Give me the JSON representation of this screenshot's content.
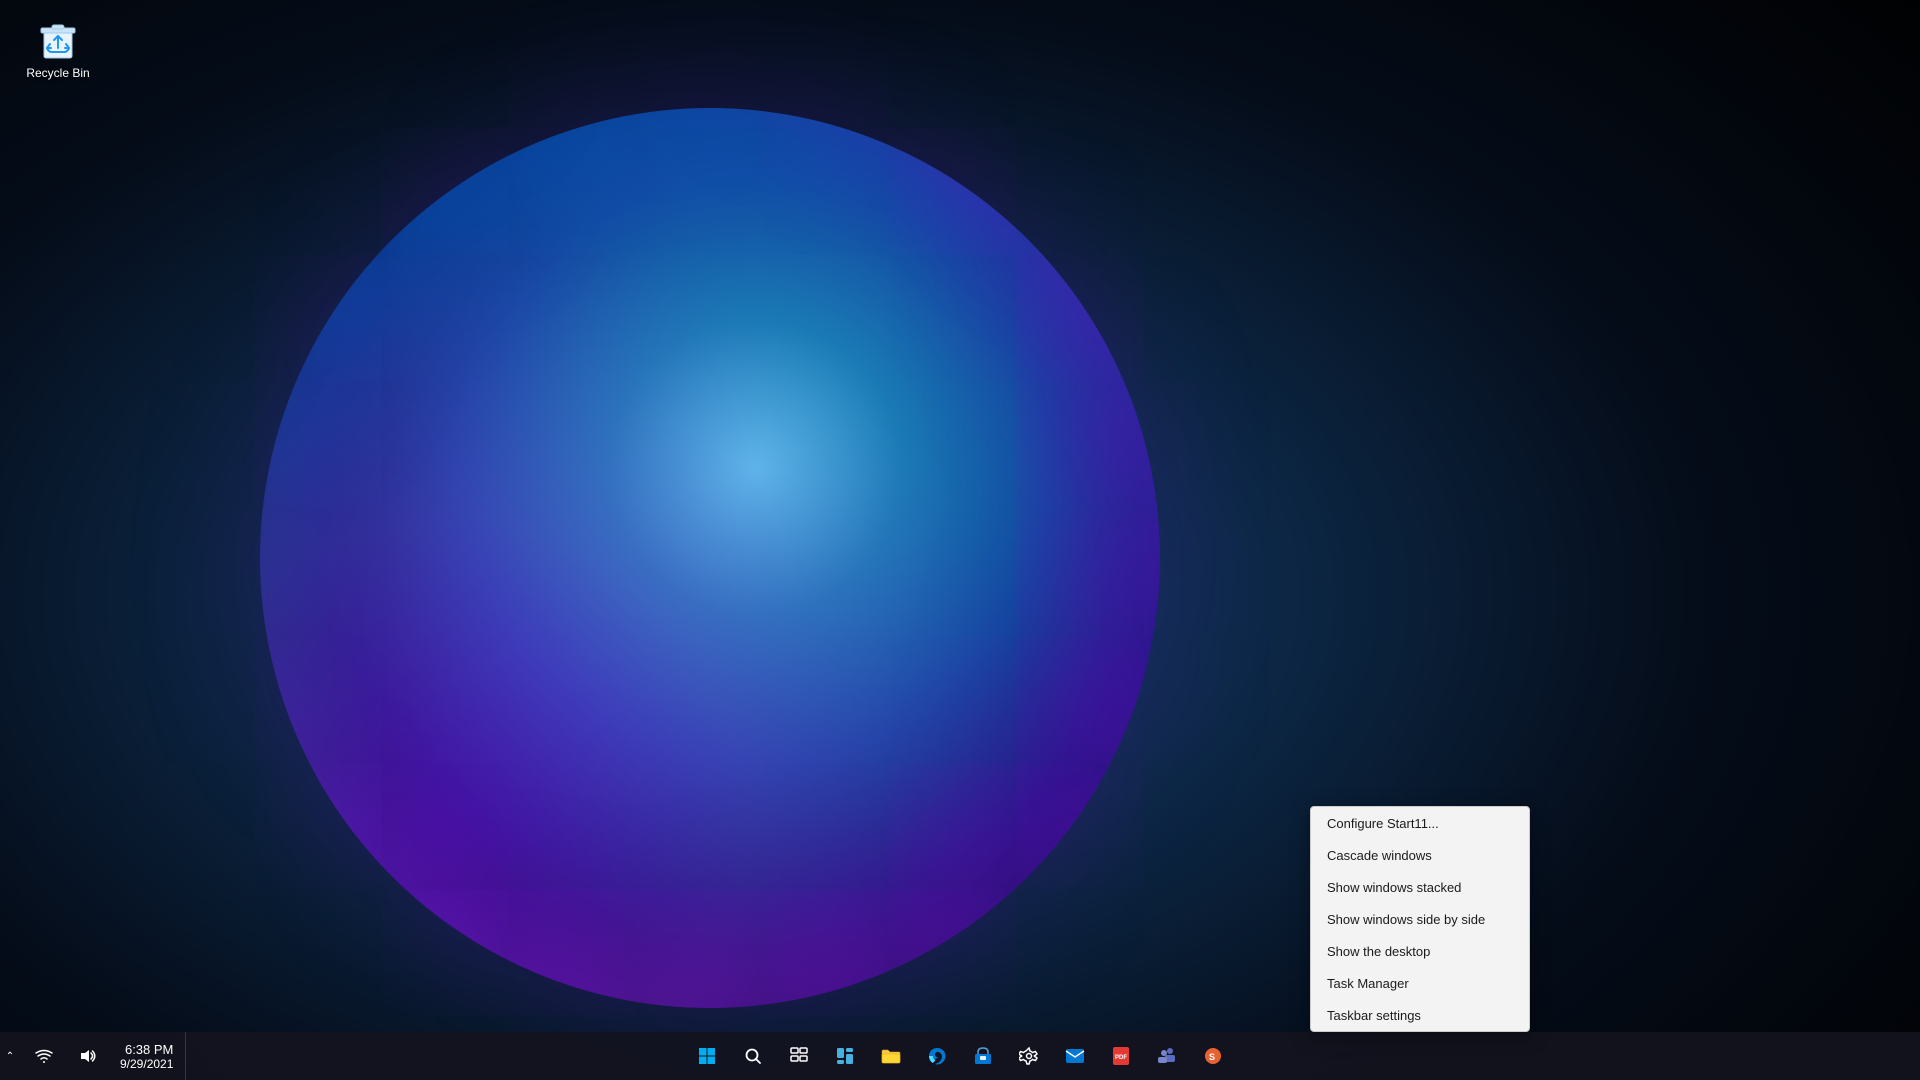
{
  "desktop": {
    "background_desc": "Windows 11 dark orb wallpaper"
  },
  "recycle_bin": {
    "label": "Recycle Bin"
  },
  "context_menu": {
    "items": [
      {
        "id": "configure-start11",
        "label": "Configure Start11...",
        "disabled": false
      },
      {
        "id": "cascade-windows",
        "label": "Cascade windows",
        "disabled": false
      },
      {
        "id": "show-windows-stacked",
        "label": "Show windows stacked",
        "disabled": false
      },
      {
        "id": "show-windows-side-by-side",
        "label": "Show windows side by side",
        "disabled": false
      },
      {
        "id": "show-the-desktop",
        "label": "Show the desktop",
        "disabled": false
      },
      {
        "id": "task-manager",
        "label": "Task Manager",
        "disabled": false
      },
      {
        "id": "taskbar-settings",
        "label": "Taskbar settings",
        "disabled": false
      }
    ]
  },
  "taskbar": {
    "buttons": [
      {
        "id": "start",
        "label": "Start"
      },
      {
        "id": "search",
        "label": "Search"
      },
      {
        "id": "task-view",
        "label": "Task View"
      },
      {
        "id": "widgets",
        "label": "Widgets"
      },
      {
        "id": "file-explorer",
        "label": "File Explorer"
      },
      {
        "id": "edge",
        "label": "Microsoft Edge"
      },
      {
        "id": "ms-store",
        "label": "Microsoft Store"
      },
      {
        "id": "settings",
        "label": "Settings"
      },
      {
        "id": "mail",
        "label": "Mail"
      },
      {
        "id": "pdf",
        "label": "PDF Tool"
      },
      {
        "id": "teams",
        "label": "Microsoft Teams"
      },
      {
        "id": "app2",
        "label": "App"
      }
    ],
    "tray": {
      "expand_label": "^",
      "icons": [
        "network",
        "volume"
      ]
    },
    "clock": {
      "time": "6:38 PM",
      "date": "9/29/2021"
    }
  }
}
